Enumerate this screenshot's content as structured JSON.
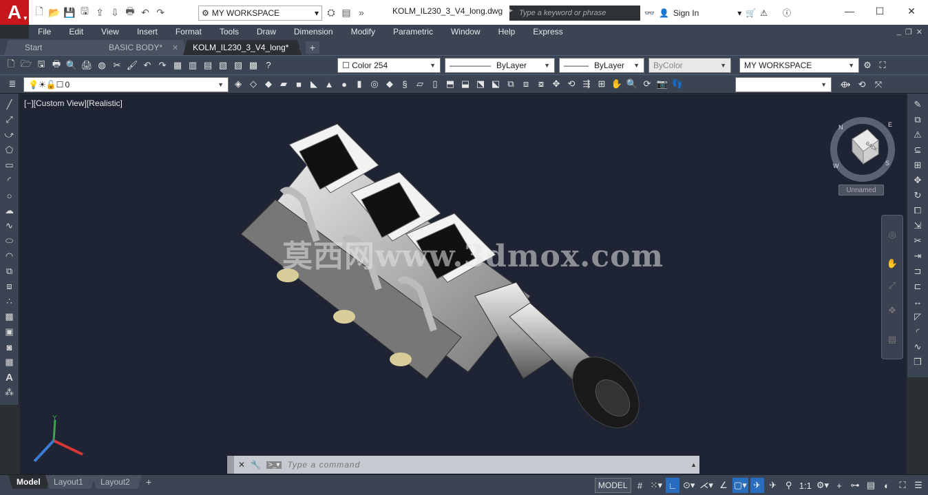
{
  "app": {
    "logo": "A"
  },
  "titlebar": {
    "workspace": "MY WORKSPACE",
    "document_title": "KOLM_IL230_3_V4_long.dwg",
    "search_placeholder": "Type a keyword or phrase",
    "signin_label": "Sign In"
  },
  "menubar": {
    "items": [
      "File",
      "Edit",
      "View",
      "Insert",
      "Format",
      "Tools",
      "Draw",
      "Dimension",
      "Modify",
      "Parametric",
      "Window",
      "Help",
      "Express"
    ]
  },
  "tabs": {
    "items": [
      {
        "label": "Start"
      },
      {
        "label": "BASIC BODY*"
      },
      {
        "label": "KOLM_IL230_3_V4_long*"
      }
    ],
    "active": 2
  },
  "properties": {
    "color": "Color 254",
    "linetype": "ByLayer",
    "lineweight": "ByLayer",
    "plotstyle": "ByColor",
    "workspace": "MY WORKSPACE",
    "layer": "0"
  },
  "viewport": {
    "label": "[−][Custom View][Realistic]",
    "watermark": "莫西网www.3dmox.com",
    "viewcube_face": "BACK",
    "compass": [
      "N",
      "E",
      "S",
      "W"
    ],
    "view_name": "Unnamed",
    "ucs_y": "Y"
  },
  "command": {
    "placeholder": "Type a command"
  },
  "layouts": {
    "items": [
      "Model",
      "Layout1",
      "Layout2"
    ],
    "active": 0
  },
  "status": {
    "model_label": "MODEL",
    "scale": "1:1"
  },
  "colors": {
    "accent": "#c8161d",
    "viewport_bg": "#1e2433",
    "chrome": "#3b4453",
    "active_toggle": "#2a6dbf"
  }
}
